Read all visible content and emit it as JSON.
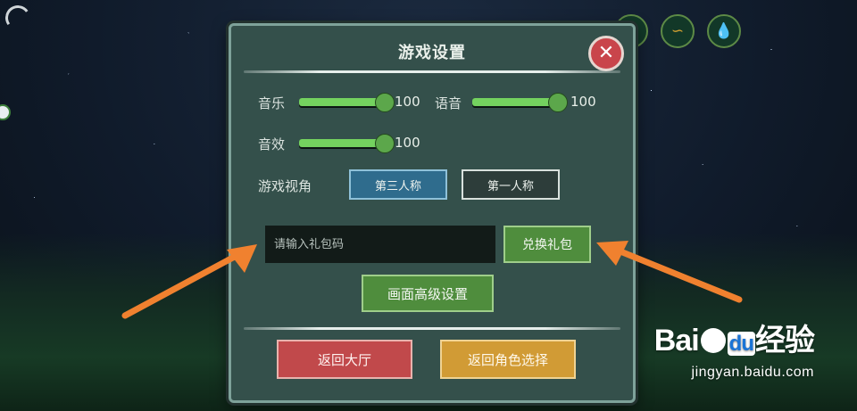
{
  "hud": {
    "top_left_icon": "arc-icon",
    "icons": [
      {
        "name": "heart-icon",
        "glyph": "❤",
        "color": "#c2343b"
      },
      {
        "name": "muscle-icon",
        "glyph": "∽",
        "color": "#d3a131"
      },
      {
        "name": "water-drop-icon",
        "glyph": "💧",
        "color": "#3ea0c8"
      }
    ]
  },
  "settings": {
    "title": "游戏设置",
    "close_glyph": "✕",
    "music": {
      "label": "音乐",
      "value": "100",
      "level": 1.0
    },
    "voice": {
      "label": "语音",
      "value": "100",
      "level": 1.0
    },
    "sfx": {
      "label": "音效",
      "value": "100",
      "level": 1.0
    },
    "view": {
      "label": "游戏视角",
      "third_person": "第三人称",
      "first_person": "第一人称",
      "selected": "第三人称"
    },
    "gift": {
      "placeholder": "请输入礼包码",
      "redeem_label": "兑换礼包"
    },
    "advanced_label": "画面高级设置",
    "back_lobby_label": "返回大厅",
    "back_role_label": "返回角色选择"
  },
  "colors": {
    "panel": "#34504b",
    "slider_fill": "#74d25f",
    "selected_view": "#2f6c8d",
    "green_button": "#4f8d3d",
    "red_button": "#c1494b",
    "orange_button": "#d19b35",
    "arrow": "#f0812f"
  },
  "watermark": {
    "logo_left": "Bai",
    "logo_du": "du",
    "logo_right": "经验",
    "url": "jingyan.baidu.com"
  }
}
